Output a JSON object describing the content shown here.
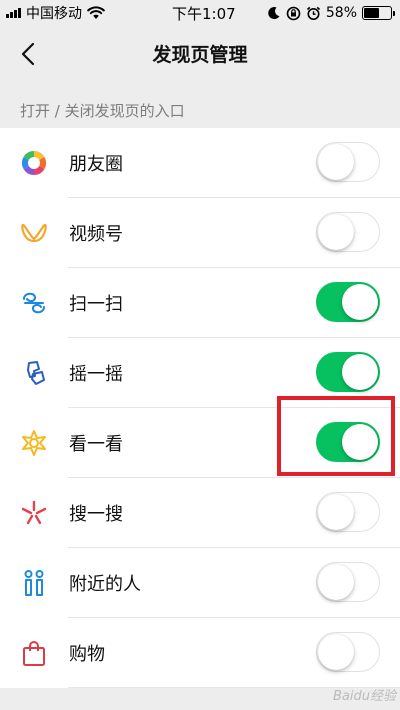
{
  "status_bar": {
    "carrier": "中国移动",
    "time": "下午1:07",
    "battery_percent": "58%",
    "battery_level": 0.58
  },
  "nav": {
    "title": "发现页管理",
    "back_icon": "chevron-left-icon"
  },
  "section": {
    "header": "打开 / 关闭发现页的入口"
  },
  "items": [
    {
      "label": "朋友圈",
      "icon": "moments-icon",
      "enabled": false
    },
    {
      "label": "视频号",
      "icon": "channels-icon",
      "enabled": false
    },
    {
      "label": "扫一扫",
      "icon": "scan-icon",
      "enabled": true
    },
    {
      "label": "摇一摇",
      "icon": "shake-icon",
      "enabled": true
    },
    {
      "label": "看一看",
      "icon": "top-stories-icon",
      "enabled": true,
      "highlighted": true
    },
    {
      "label": "搜一搜",
      "icon": "search-icon",
      "enabled": false
    },
    {
      "label": "附近的人",
      "icon": "people-nearby-icon",
      "enabled": false
    },
    {
      "label": "购物",
      "icon": "shopping-bag-icon",
      "enabled": false
    }
  ],
  "colors": {
    "toggle_on": "#07c160",
    "highlight": "#e0202a"
  },
  "watermark": "Baidu经验"
}
